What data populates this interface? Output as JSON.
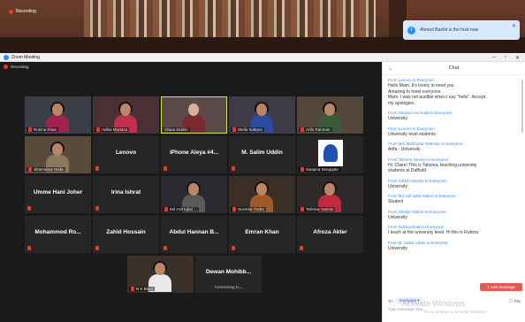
{
  "top": {
    "recording": "Recording",
    "toast": "Ahmed Bashir is the host now"
  },
  "window": {
    "title": "Zoom Meeting"
  },
  "meeting": {
    "recording": "Recording",
    "row1": [
      {
        "name": "Rubina Khan"
      },
      {
        "name": "Adiba Murtaza"
      },
      {
        "name": "Olana Siddiki"
      },
      {
        "name": "Stella Sultana"
      },
      {
        "name": "Arifa Rahman"
      }
    ],
    "row2": [
      {
        "name": "Shamsiara Huda"
      },
      {
        "name": "Lenovo"
      },
      {
        "name": "iPhone Aleya #4..."
      },
      {
        "name": "M. Salim Uddin"
      },
      {
        "name": "Swapna Sengupta"
      }
    ],
    "row3": [
      {
        "name": "Umme Hani Joher"
      },
      {
        "name": "Irina Ishrat"
      },
      {
        "name": "Md Asif Iqbal ..."
      },
      {
        "name": "Susmita Trisha"
      },
      {
        "name": "Tahsina Yasmin"
      }
    ],
    "row4": [
      {
        "name": "Mohammod Ro..."
      },
      {
        "name": "Zahid Hossain"
      },
      {
        "name": "Abdul Hannan B..."
      },
      {
        "name": "Emran Khan"
      },
      {
        "name": "Afroza Akter"
      }
    ],
    "row5": [
      {
        "name": "N K Bipul"
      },
      {
        "name": "Dewan Mohibb...",
        "sub": "Connecting to..."
      }
    ]
  },
  "chat": {
    "title": "Chat",
    "messages": [
      {
        "from": "From Lenovo to Everyone:",
        "lines": [
          "Hello Mam. It's lovely to meet you",
          "Amazing to meet everyone",
          "Mam. I was not audible when I say \"hello\". Accept",
          "my apologies."
        ]
      },
      {
        "from": "From Shamsi Ara Huda to Everyone:",
        "lines": [
          "University"
        ]
      },
      {
        "from": "From Lenovo to Everyone:",
        "lines": [
          "University level students"
        ]
      },
      {
        "from": "From Mrs Mahbubar Rahman to Everyone:",
        "lines": [
          "Arifa - University"
        ]
      },
      {
        "from": "From Tahsina Yasmin to Everyone:",
        "lines": [
          "Hi, Claire! This is Tahsina, teaching university",
          "students at Daffodil."
        ]
      },
      {
        "from": "From Zahid Hossain to Everyone:",
        "lines": [
          "University"
        ]
      },
      {
        "from": "From Md Asif Iqbal Saikot to Everyone:",
        "lines": [
          "Student"
        ]
      },
      {
        "from": "From Shahjin Mahin to Everyone:",
        "lines": [
          "University"
        ]
      },
      {
        "from": "From Rubina Khan to Everyone:",
        "lines": [
          "I teach at the university level.  Hi this is Rubina"
        ]
      },
      {
        "from": "From M. Salim Uddin to Everyone:",
        "lines": [
          "University"
        ]
      }
    ],
    "new_message": "1 new message",
    "to_label": "To:",
    "to_value": "Everyone",
    "file_label": "File",
    "input_placeholder": "Type message here..."
  },
  "watermark": {
    "title": "Activate Windows",
    "sub": "Go to Settings to activate Windows."
  }
}
